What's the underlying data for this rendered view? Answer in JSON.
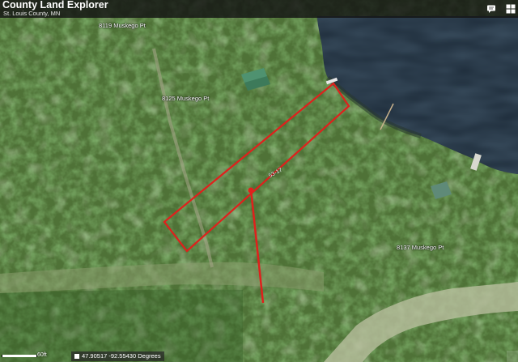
{
  "header": {
    "title": "County Land Explorer",
    "subtitle": "St. Louis County, MN",
    "icons": [
      "comment-icon",
      "grid-icon"
    ]
  },
  "map": {
    "type": "aerial-imagery",
    "labels": {
      "address_1": "8119 Muskego Pt",
      "address_2": "8125 Muskego Pt",
      "address_3": "8137 Muskego Pt",
      "parcel_id": "53-17"
    },
    "highlight_color": "#e0201c"
  },
  "footer": {
    "scale_label": "60ft",
    "coordinates": "47.90517 -92.55430 Degrees"
  }
}
